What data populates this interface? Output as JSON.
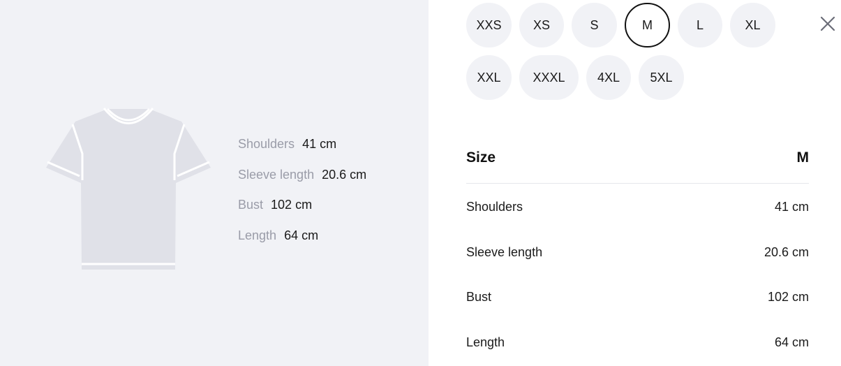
{
  "measurements": [
    {
      "label": "Shoulders",
      "value": "41 cm"
    },
    {
      "label": "Sleeve length",
      "value": "20.6 cm"
    },
    {
      "label": "Bust",
      "value": "102 cm"
    },
    {
      "label": "Length",
      "value": "64 cm"
    }
  ],
  "sizes": [
    "XXS",
    "XS",
    "S",
    "M",
    "L",
    "XL",
    "XXL",
    "XXXL",
    "4XL",
    "5XL"
  ],
  "selected_size": "M",
  "table": {
    "header_label": "Size",
    "header_value": "M"
  },
  "icons": {
    "close": "close-icon",
    "garment": "tshirt-icon"
  },
  "colors": {
    "panel_bg": "#f1f2f6",
    "pill_bg": "#f1f2f6",
    "selected_border": "#111111",
    "muted_text": "#9a9ca8",
    "shirt_fill": "#e0e1e8"
  }
}
